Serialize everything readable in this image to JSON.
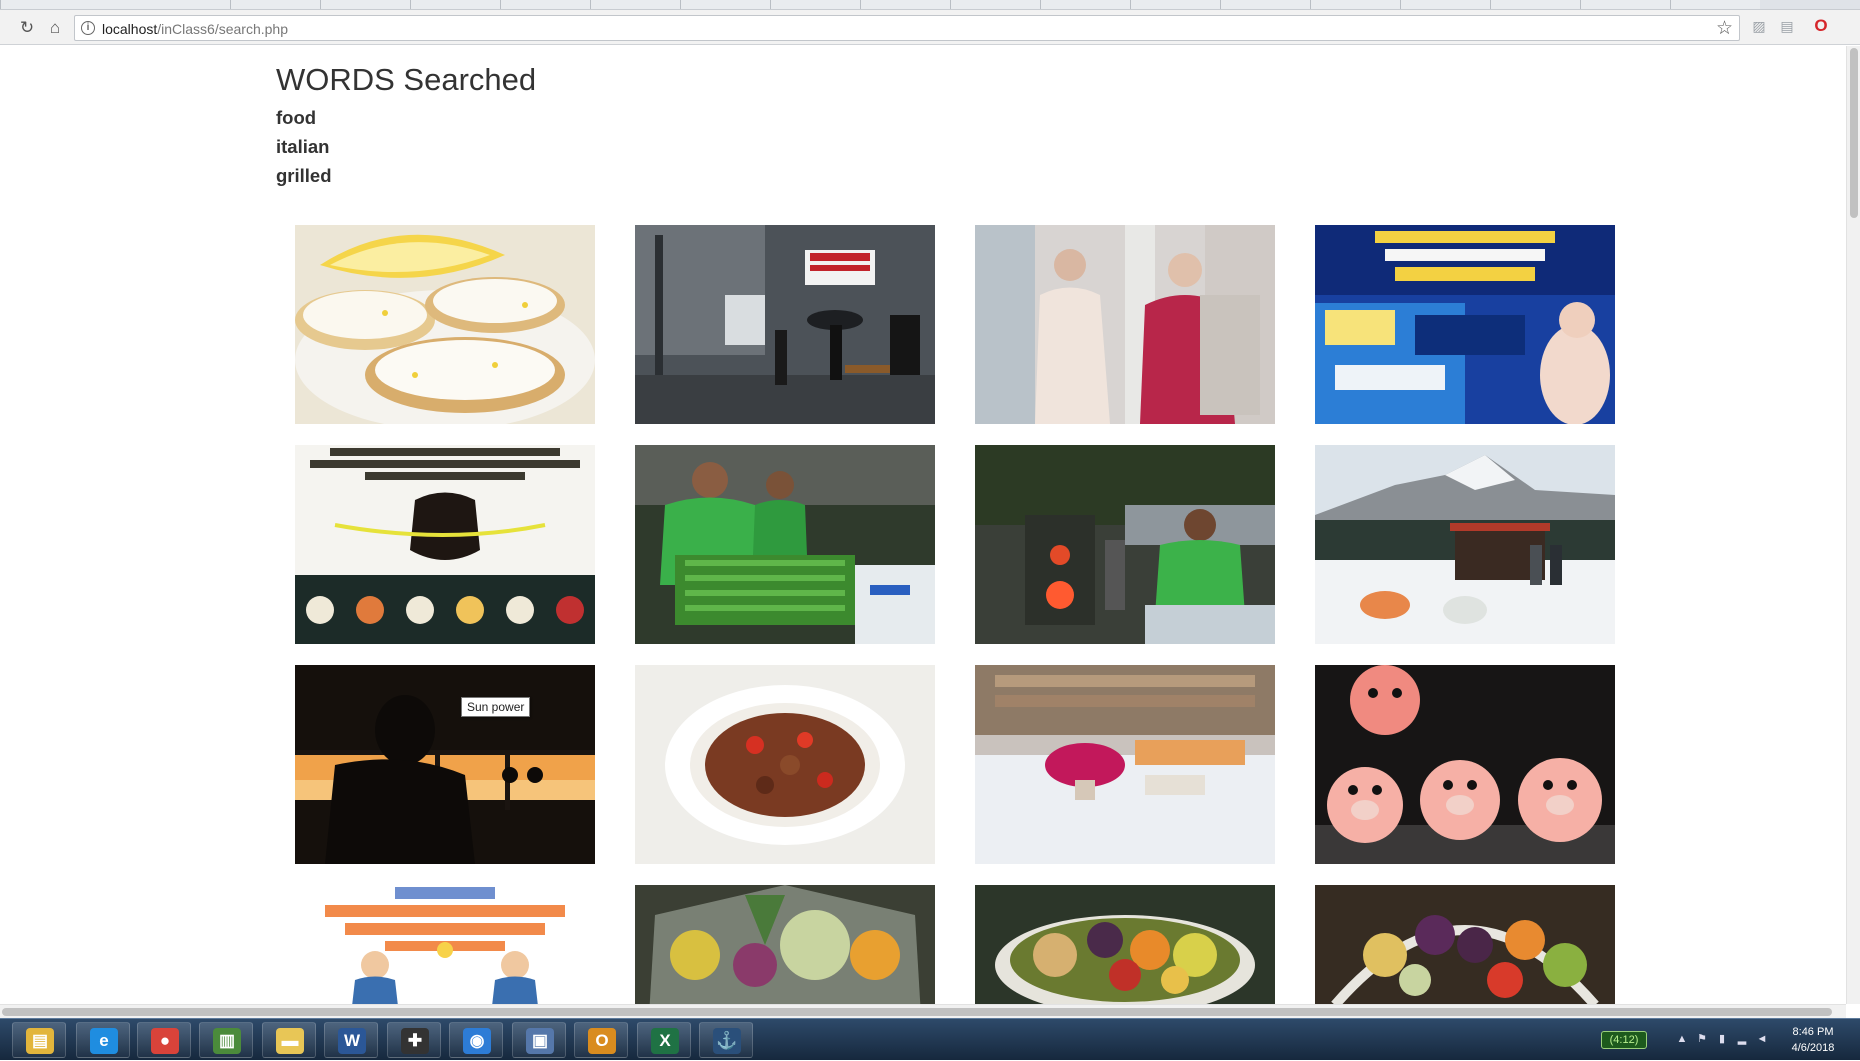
{
  "browser": {
    "url_host": "localhost",
    "url_path": "/inClass6/search.php"
  },
  "page": {
    "heading": "WORDS Searched",
    "words": [
      "food",
      "italian",
      "grilled"
    ],
    "tooltip": "Sun power"
  },
  "images": [
    {
      "name": "lemon-cookies-photo",
      "bg": "#e8e2cf"
    },
    {
      "name": "rainy-street-market-photo",
      "bg": "#5a5d62"
    },
    {
      "name": "two-women-window-photo",
      "bg": "#cfc7c4"
    },
    {
      "name": "lottery-ad-banner",
      "bg": "#1b4aa8"
    },
    {
      "name": "military-diet-infographic",
      "bg": "#f2f2ee"
    },
    {
      "name": "street-vendor-grilling-photo",
      "bg": "#2f4a2b"
    },
    {
      "name": "vendor-grill-stall-photo",
      "bg": "#3a4a3c"
    },
    {
      "name": "snow-mountain-cabin-photo",
      "bg": "#c9d3dc"
    },
    {
      "name": "sunset-silhouette-photo",
      "bg": "#1a1410"
    },
    {
      "name": "stew-plate-photo",
      "bg": "#ecebe6"
    },
    {
      "name": "dessert-table-photo",
      "bg": "#cfc9c6"
    },
    {
      "name": "pig-cookies-photo",
      "bg": "#1c1a1a"
    },
    {
      "name": "lose-weight-infographic",
      "bg": "#ffffff"
    },
    {
      "name": "fruit-basket-wrapped-photo",
      "bg": "#3a3e30"
    },
    {
      "name": "fruit-bowl-photo",
      "bg": "#2e3a2c"
    },
    {
      "name": "fruit-basket-photo",
      "bg": "#3b3228"
    }
  ],
  "taskbar": {
    "apps": [
      {
        "name": "file-explorer-icon",
        "glyph": "▤",
        "color": "#e2b53c"
      },
      {
        "name": "internet-explorer-icon",
        "glyph": "e",
        "color": "#1f8de0"
      },
      {
        "name": "chrome-icon",
        "glyph": "●",
        "color": "#d9433a"
      },
      {
        "name": "project-app-icon",
        "glyph": "▥",
        "color": "#4b8b3b"
      },
      {
        "name": "folder-icon",
        "glyph": "▬",
        "color": "#e8c656"
      },
      {
        "name": "word-icon",
        "glyph": "W",
        "color": "#2b5797"
      },
      {
        "name": "sticky-tool-icon",
        "glyph": "✚",
        "color": "#333333"
      },
      {
        "name": "maps-icon",
        "glyph": "◉",
        "color": "#2d7cd6"
      },
      {
        "name": "remote-desktop-icon",
        "glyph": "▣",
        "color": "#5577aa"
      },
      {
        "name": "outlook-icon",
        "glyph": "O",
        "color": "#d98c1f"
      },
      {
        "name": "excel-icon",
        "glyph": "X",
        "color": "#1f7244"
      },
      {
        "name": "mysql-workbench-icon",
        "glyph": "⚓",
        "color": "#2a4f7a"
      }
    ],
    "battery_text": "(4:12)",
    "time": "8:46 PM",
    "date": "4/6/2018"
  }
}
